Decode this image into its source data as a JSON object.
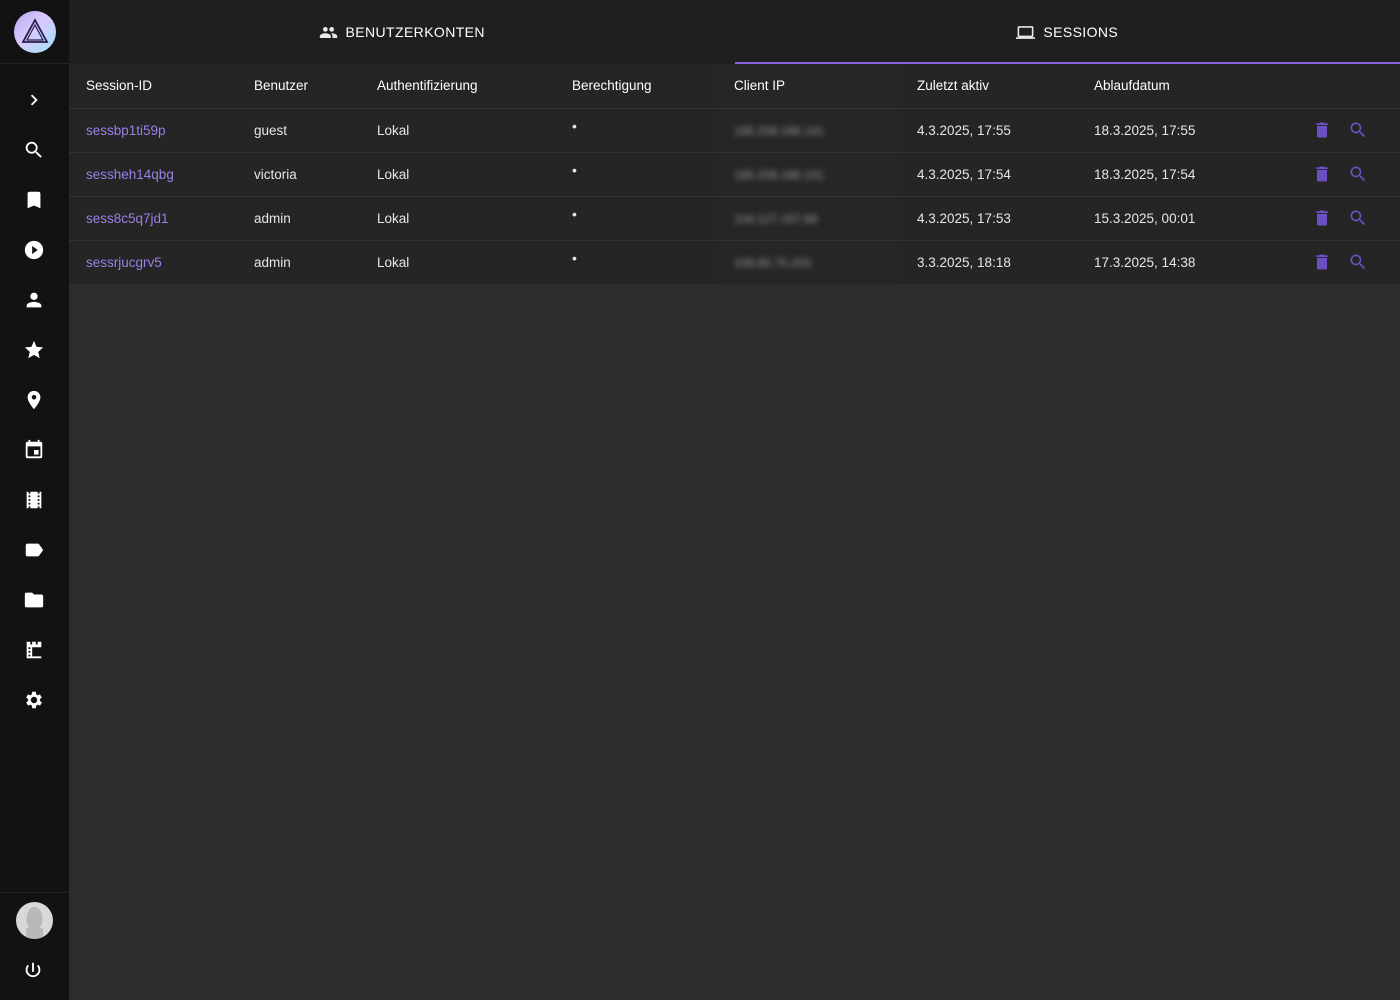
{
  "tabs": [
    {
      "label": "BENUTZERKONTEN",
      "icon": "people-icon",
      "active": false
    },
    {
      "label": "SESSIONS",
      "icon": "laptop-icon",
      "active": true
    }
  ],
  "table": {
    "headers": [
      "Session-ID",
      "Benutzer",
      "Authentifizierung",
      "Berechtigung",
      "Client IP",
      "Zuletzt aktiv",
      "Ablaufdatum"
    ],
    "rows": [
      {
        "session_id": "sessbp1ti59p",
        "user": "guest",
        "auth": "Lokal",
        "permission": "•",
        "client_ip": "185.208.166.141",
        "last_active": "4.3.2025, 17:55",
        "expires": "18.3.2025, 17:55"
      },
      {
        "session_id": "sessheh14qbg",
        "user": "victoria",
        "auth": "Lokal",
        "permission": "•",
        "client_ip": "185.208.166.141",
        "last_active": "4.3.2025, 17:54",
        "expires": "18.3.2025, 17:54"
      },
      {
        "session_id": "sess8c5q7jd1",
        "user": "admin",
        "auth": "Lokal",
        "permission": "•",
        "client_ip": "104.127.167.88",
        "last_active": "4.3.2025, 17:53",
        "expires": "15.3.2025, 00:01"
      },
      {
        "session_id": "sessrjucgrv5",
        "user": "admin",
        "auth": "Lokal",
        "permission": "•",
        "client_ip": "109.85.75.203",
        "last_active": "3.3.2025, 18:18",
        "expires": "17.3.2025, 14:38"
      }
    ]
  },
  "colors": {
    "accent": "#8a64e0",
    "link": "#9a80e6",
    "action_icon": "#6d4fc4",
    "sidebar_bg": "#121212",
    "tabs_bg": "#1f1f1f",
    "page_bg": "#2c2c2c"
  }
}
